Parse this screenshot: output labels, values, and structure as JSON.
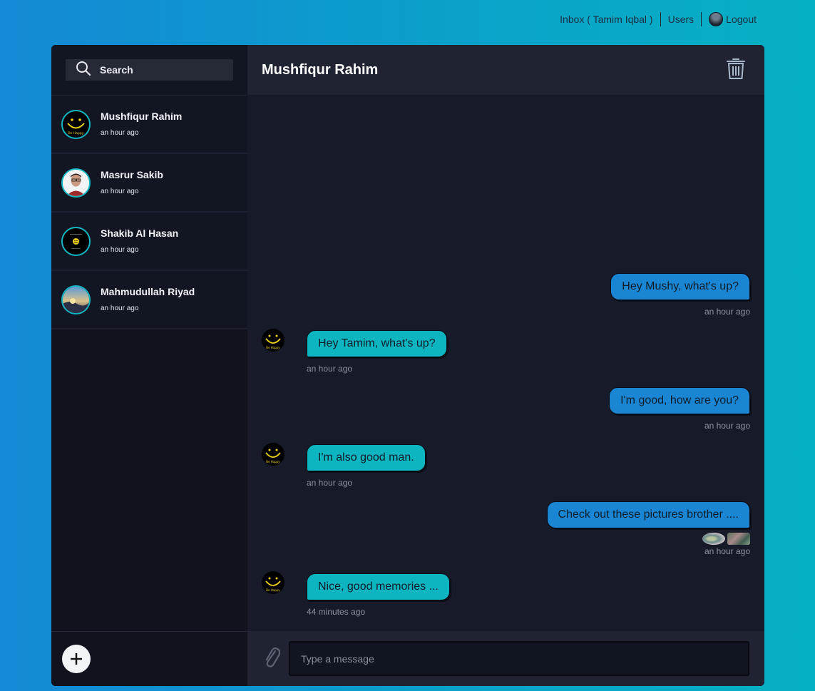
{
  "nav": {
    "inbox": "Inbox ( Tamim Iqbal )",
    "users": "Users",
    "logout": "Logout"
  },
  "search": {
    "placeholder": "Search"
  },
  "conversations": [
    {
      "name": "Mushfiqur Rahim",
      "time": "an hour ago",
      "avatar": "smiley-be-happy"
    },
    {
      "name": "Masrur Sakib",
      "time": "an hour ago",
      "avatar": "portrait-photo"
    },
    {
      "name": "Shakib Al Hasan",
      "time": "an hour ago",
      "avatar": "small-smiley"
    },
    {
      "name": "Mahmudullah Riyad",
      "time": "an hour ago",
      "avatar": "landscape-photo"
    }
  ],
  "chat": {
    "title": "Mushfiqur Rahim",
    "input_placeholder": "Type a message",
    "messages": [
      {
        "dir": "sent",
        "text": "Hey Mushy, what's up?",
        "time": "an hour ago"
      },
      {
        "dir": "recv",
        "text": "Hey Tamim, what's up?",
        "time": "an hour ago"
      },
      {
        "dir": "sent",
        "text": "I'm good, how are you?",
        "time": "an hour ago"
      },
      {
        "dir": "recv",
        "text": "I'm also good man.",
        "time": "an hour ago"
      },
      {
        "dir": "sent",
        "text": "Check out these pictures brother ....",
        "time": "an hour ago",
        "attachments": 2
      },
      {
        "dir": "recv",
        "text": "Nice, good memories ...",
        "time": "44 minutes ago"
      }
    ]
  },
  "colors": {
    "sent_bubble": "#1a86d3",
    "recv_bubble": "#0cb5c0",
    "avatar_ring": "#13b6c3"
  }
}
